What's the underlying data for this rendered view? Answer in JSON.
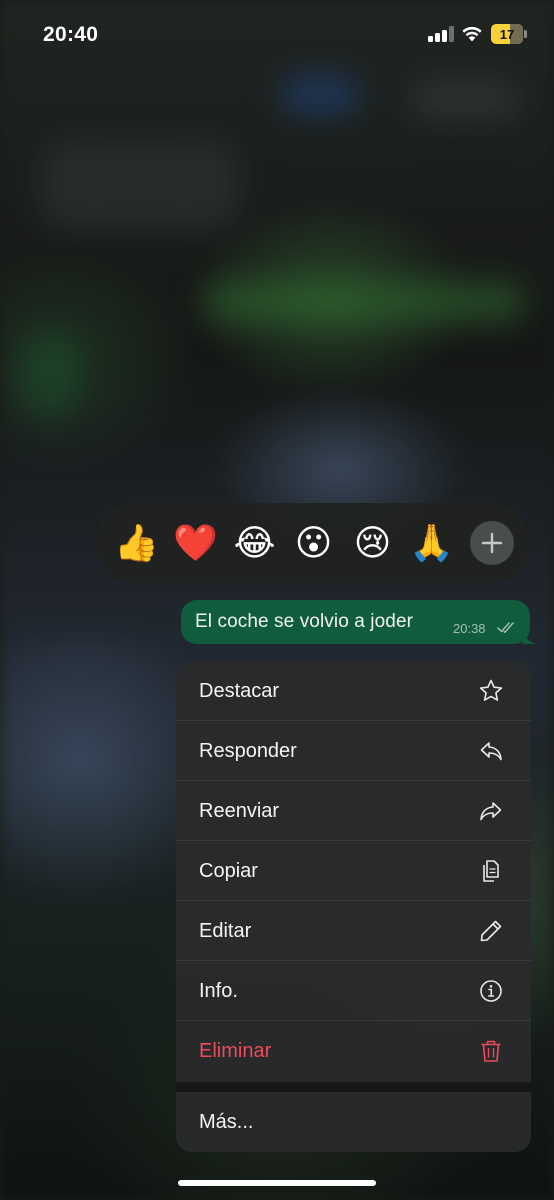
{
  "status_bar": {
    "time": "20:40",
    "battery_level": "17",
    "signal_bars_active": 3,
    "signal_bars_total": 4,
    "battery_color": "#f7d23a"
  },
  "reactions": {
    "emojis": [
      {
        "icon": "thumbs-up-icon",
        "glyph": "👍"
      },
      {
        "icon": "red-heart-icon",
        "glyph": "❤️"
      },
      {
        "icon": "tears-of-joy-icon",
        "glyph": "😂"
      },
      {
        "icon": "surprised-face-icon",
        "glyph": "😮"
      },
      {
        "icon": "crying-face-icon",
        "glyph": "😢"
      },
      {
        "icon": "folded-hands-icon",
        "glyph": "🙏"
      }
    ],
    "more_icon": "plus-icon"
  },
  "message": {
    "text": "El coche se volvio a joder",
    "time": "20:38",
    "status_icon": "double-check-icon",
    "bubble_color": "#105d3d"
  },
  "menu": {
    "items": [
      {
        "label": "Destacar",
        "icon": "star-icon"
      },
      {
        "label": "Responder",
        "icon": "reply-icon"
      },
      {
        "label": "Reenviar",
        "icon": "forward-icon"
      },
      {
        "label": "Copiar",
        "icon": "copy-icon"
      },
      {
        "label": "Editar",
        "icon": "pencil-icon"
      },
      {
        "label": "Info.",
        "icon": "info-icon"
      },
      {
        "label": "Eliminar",
        "icon": "trash-icon",
        "destructive": true
      }
    ],
    "more_label": "Más...",
    "destructive_color": "#ec4b5e"
  }
}
